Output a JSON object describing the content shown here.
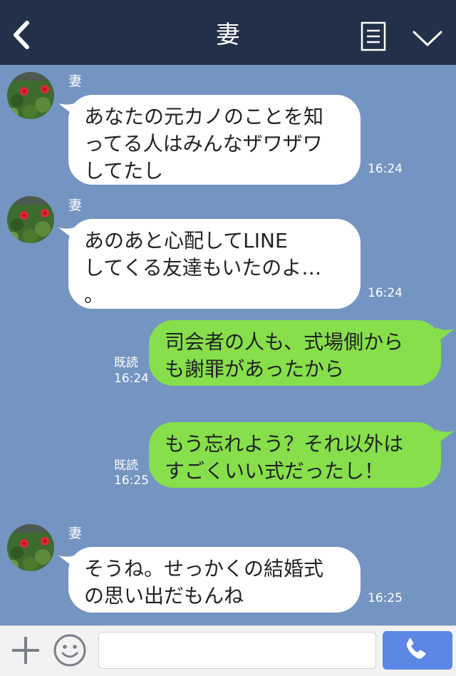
{
  "header": {
    "title": "妻",
    "back_icon": "chevron-left-icon",
    "menu_icon": "note-menu-icon",
    "dropdown_icon": "chevron-down-icon"
  },
  "messages": [
    {
      "side": "in",
      "sender": "妻",
      "text": "あなたの元カノのことを知\nってる人はみんなザワザワ\nしてたし",
      "time": "16:24"
    },
    {
      "side": "in",
      "sender": "妻",
      "text": "あのあと心配してLINE\nしてくる友達もいたのよ…\n。",
      "time": "16:24"
    },
    {
      "side": "out",
      "read": "既読",
      "text": "司会者の人も、式場側から\nも謝罪があったから",
      "time": "16:24"
    },
    {
      "side": "out",
      "read": "既読",
      "text": "もう忘れよう？それ以外は\nすごくいい式だったし！",
      "time": "16:25"
    },
    {
      "side": "in",
      "sender": "妻",
      "text": "そうね。せっかくの結婚式\nの思い出だもんね",
      "time": "16:25"
    }
  ],
  "input_bar": {
    "plus_icon": "plus-icon",
    "emoji_icon": "smiley-icon",
    "placeholder": "",
    "call_icon": "phone-icon"
  },
  "colors": {
    "header_bg": "#233049",
    "chat_bg": "#7494c1",
    "incoming_bubble": "#ffffff",
    "outgoing_bubble": "#86df4b",
    "call_button": "#5b86e4"
  }
}
